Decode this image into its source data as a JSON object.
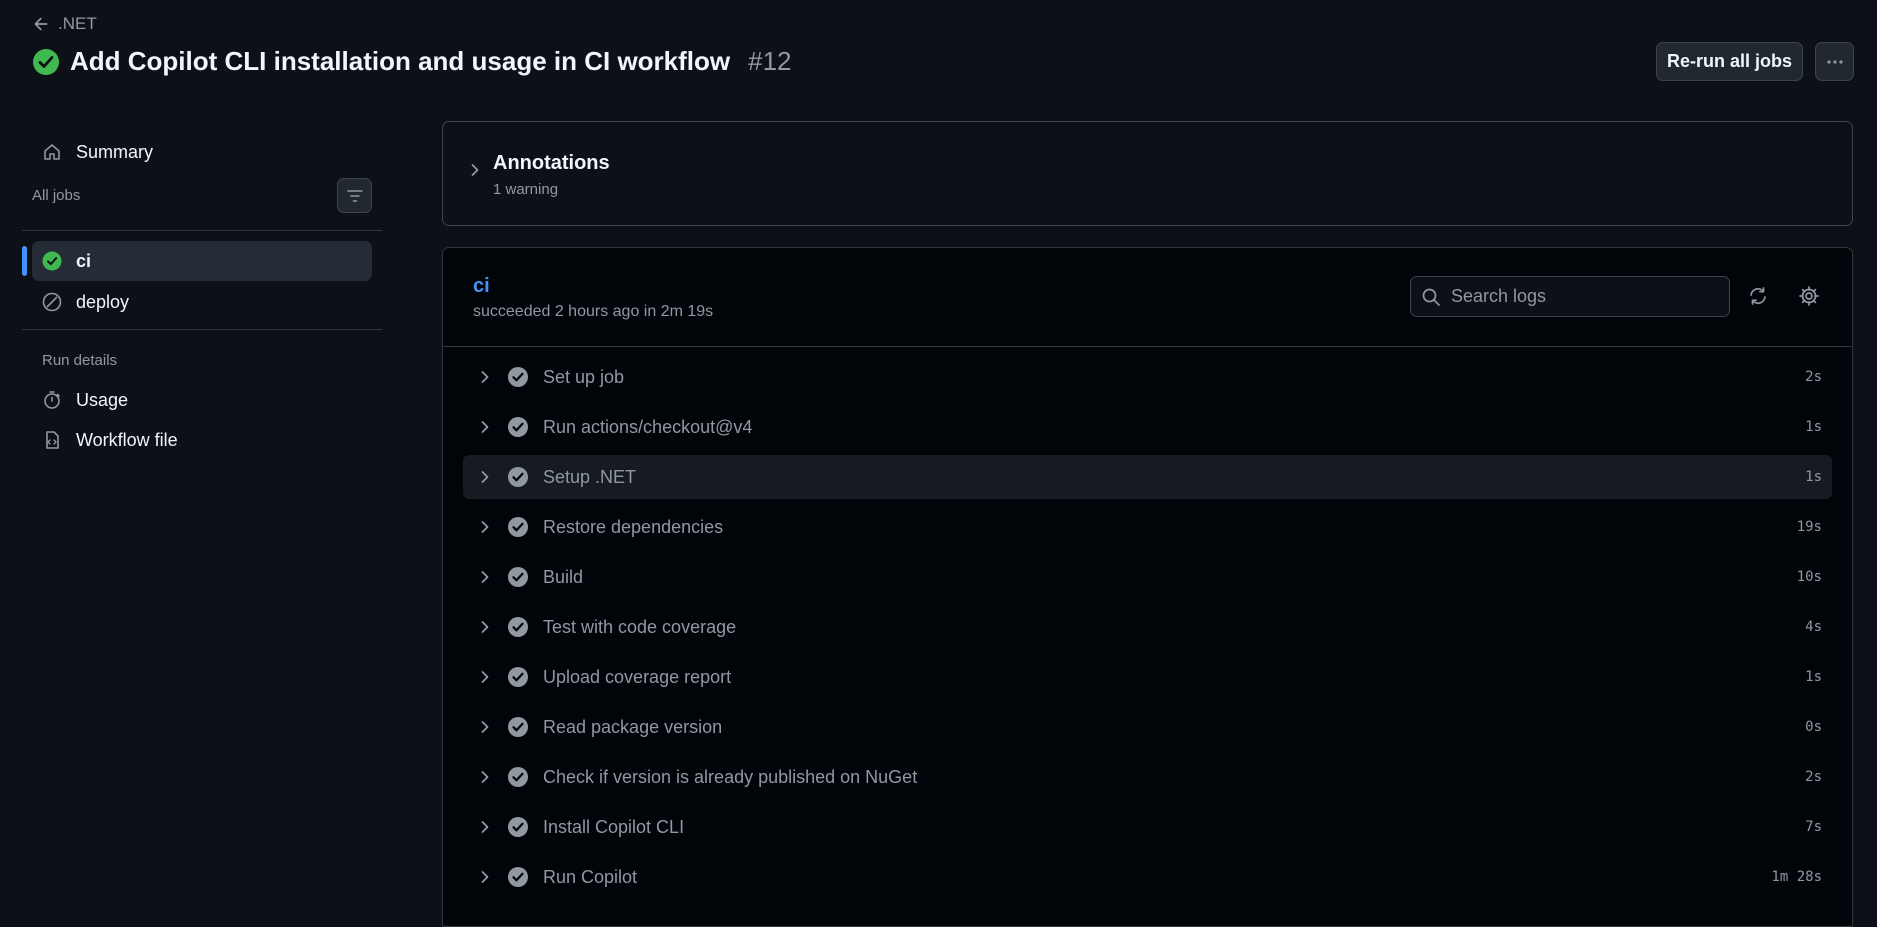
{
  "header": {
    "back_label": ".NET",
    "title": "Add Copilot CLI installation and usage in CI workflow",
    "run_number": "#12",
    "rerun_label": "Re-run all jobs"
  },
  "sidebar": {
    "summary": "Summary",
    "all_jobs": "All jobs",
    "jobs": [
      {
        "label": "ci",
        "status": "success"
      },
      {
        "label": "deploy",
        "status": "skipped"
      }
    ],
    "run_details": "Run details",
    "usage": "Usage",
    "workflow_file": "Workflow file"
  },
  "annotations": {
    "title": "Annotations",
    "subtitle": "1 warning"
  },
  "job": {
    "name": "ci",
    "status": "succeeded 2 hours ago in 2m 19s",
    "search_placeholder": "Search logs",
    "steps": [
      {
        "name": "Set up job",
        "duration": "2s"
      },
      {
        "name": "Run actions/checkout@v4",
        "duration": "1s"
      },
      {
        "name": "Setup .NET",
        "duration": "1s"
      },
      {
        "name": "Restore dependencies",
        "duration": "19s"
      },
      {
        "name": "Build",
        "duration": "10s"
      },
      {
        "name": "Test with code coverage",
        "duration": "4s"
      },
      {
        "name": "Upload coverage report",
        "duration": "1s"
      },
      {
        "name": "Read package version",
        "duration": "0s"
      },
      {
        "name": "Check if version is already published on NuGet",
        "duration": "2s"
      },
      {
        "name": "Install Copilot CLI",
        "duration": "7s"
      },
      {
        "name": "Run Copilot",
        "duration": "1m 28s"
      }
    ]
  },
  "colors": {
    "success": "#3fb950",
    "accent": "#4493f8",
    "muted": "#9198a1",
    "background": "#0d1117"
  }
}
